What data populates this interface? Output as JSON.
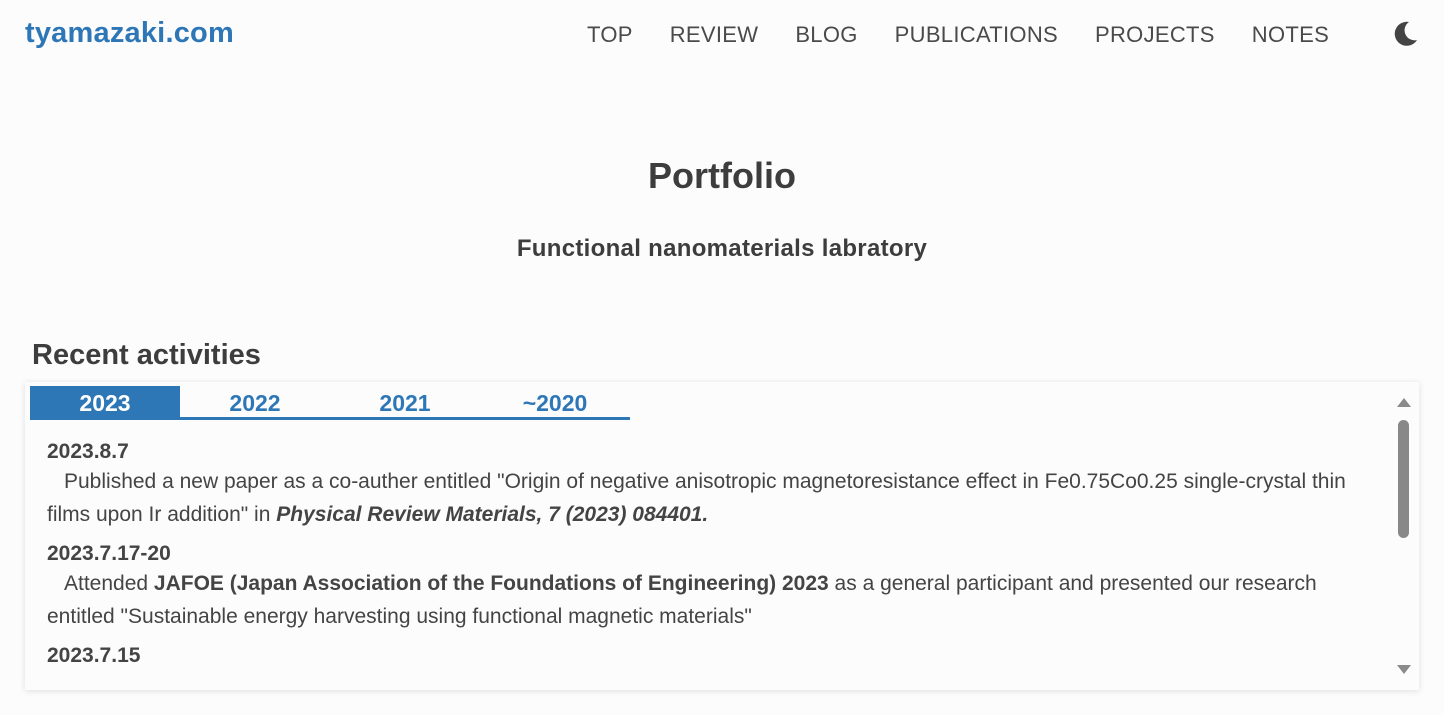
{
  "site": {
    "logo": "tyamazaki.com"
  },
  "nav": {
    "items": [
      "TOP",
      "REVIEW",
      "BLOG",
      "PUBLICATIONS",
      "PROJECTS",
      "NOTES"
    ],
    "theme_icon": "moon-icon"
  },
  "page": {
    "title": "Portfolio",
    "subtitle": "Functional nanomaterials labratory"
  },
  "activities": {
    "heading": "Recent activities",
    "tabs": [
      "2023",
      "2022",
      "2021",
      "~2020"
    ],
    "active_tab": "2023",
    "entries": [
      {
        "date": "2023.8.7",
        "text_before": "Published a new paper as a co-auther entitled \"Origin of negative anisotropic magnetoresistance effect in Fe0.75Co0.25 single-crystal thin films upon Ir addition\" in ",
        "emphasis": "Physical Review Materials, 7 (2023) 084401."
      },
      {
        "date": "2023.7.17-20",
        "text_before": "Attended ",
        "strong": "JAFOE (Japan Association of the Foundations of Engineering) 2023",
        "text_after": " as a general participant and presented our research entitled \"Sustainable energy harvesting using functional magnetic materials\""
      },
      {
        "date": "2023.7.15"
      }
    ]
  },
  "colors": {
    "accent": "#2e77b7",
    "text": "#444444",
    "background": "#fcfcfc"
  }
}
